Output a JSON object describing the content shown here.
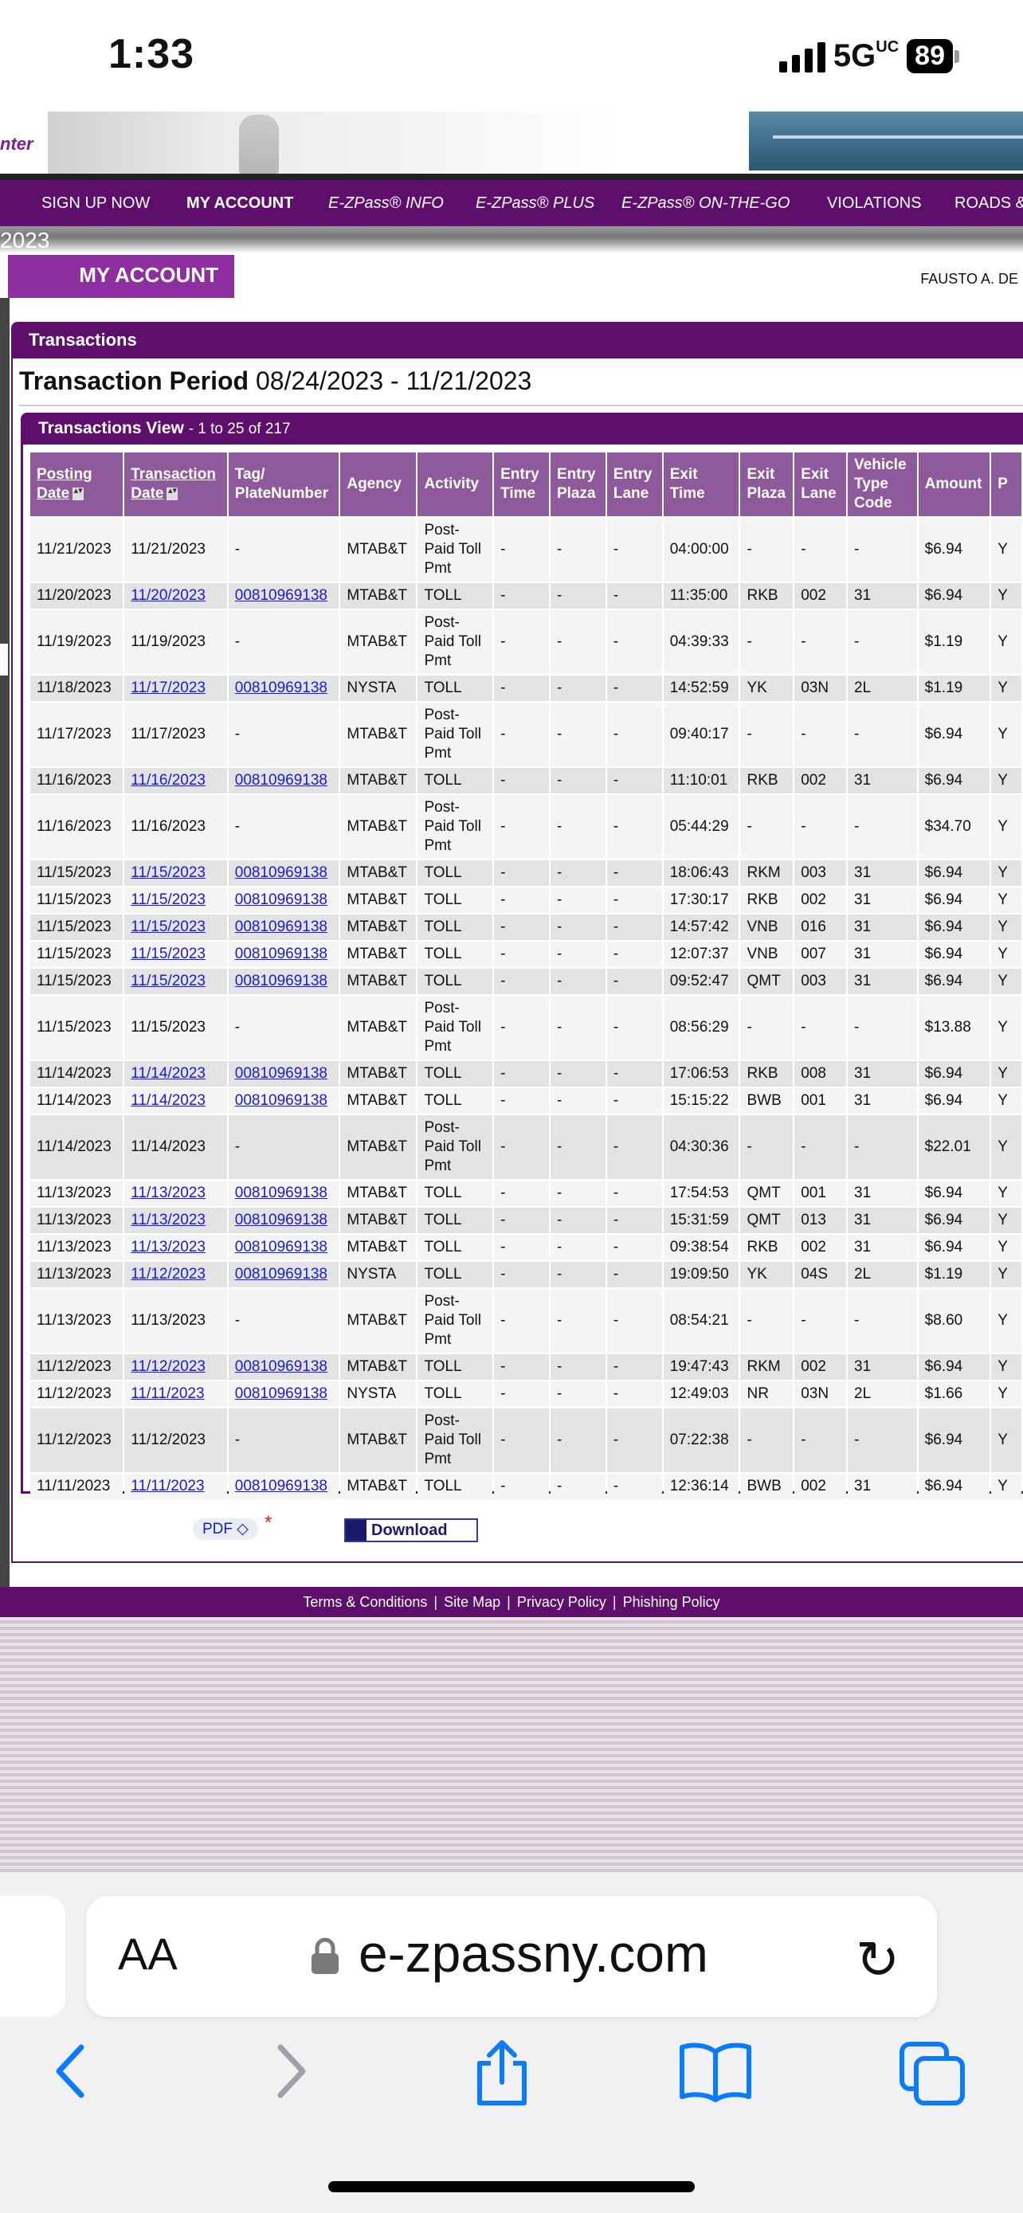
{
  "status_bar": {
    "time": "1:33",
    "network": "5G",
    "network_suffix": "UC",
    "battery": "89"
  },
  "banner": {
    "logo_text": "nter",
    "year": "2023"
  },
  "nav": {
    "items": [
      {
        "label": "SIGN UP NOW"
      },
      {
        "label": "MY ACCOUNT"
      },
      {
        "label": "E-ZPass® INFO"
      },
      {
        "label": "E-ZPass® PLUS"
      },
      {
        "label": "E-ZPass® ON-THE-GO"
      },
      {
        "label": "VIOLATIONS"
      },
      {
        "label": "ROADS &"
      }
    ]
  },
  "account": {
    "tab_label": "MY ACCOUNT",
    "user_name": "FAUSTO A. DE"
  },
  "transactions": {
    "panel_title": "Transactions",
    "period_label": "Transaction Period",
    "period_value": "08/24/2023 - 11/21/2023",
    "view_title": "Transactions View",
    "view_count": "- 1 to 25 of 217",
    "columns": [
      "Posting Date",
      "Transaction Date",
      "Tag/ PlateNumber",
      "Agency",
      "Activity",
      "Entry Time",
      "Entry Plaza",
      "Entry Lane",
      "Exit Time",
      "Exit Plaza",
      "Exit Lane",
      "Vehicle Type Code",
      "Amount",
      "P"
    ],
    "rows": [
      [
        "11/21/2023",
        "11/21/2023",
        "-",
        "MTAB&T",
        "Post-Paid Toll Pmt",
        "-",
        "-",
        "-",
        "04:00:00",
        "-",
        "-",
        "-",
        "$6.94",
        "Y"
      ],
      [
        "11/20/2023",
        "11/20/2023",
        "00810969138",
        "MTAB&T",
        "TOLL",
        "-",
        "-",
        "-",
        "11:35:00",
        "RKB",
        "002",
        "31",
        "$6.94",
        "Y"
      ],
      [
        "11/19/2023",
        "11/19/2023",
        "-",
        "MTAB&T",
        "Post-Paid Toll Pmt",
        "-",
        "-",
        "-",
        "04:39:33",
        "-",
        "-",
        "-",
        "$1.19",
        "Y"
      ],
      [
        "11/18/2023",
        "11/17/2023",
        "00810969138",
        "NYSTA",
        "TOLL",
        "-",
        "-",
        "-",
        "14:52:59",
        "YK",
        "03N",
        "2L",
        "$1.19",
        "Y"
      ],
      [
        "11/17/2023",
        "11/17/2023",
        "-",
        "MTAB&T",
        "Post-Paid Toll Pmt",
        "-",
        "-",
        "-",
        "09:40:17",
        "-",
        "-",
        "-",
        "$6.94",
        "Y"
      ],
      [
        "11/16/2023",
        "11/16/2023",
        "00810969138",
        "MTAB&T",
        "TOLL",
        "-",
        "-",
        "-",
        "11:10:01",
        "RKB",
        "002",
        "31",
        "$6.94",
        "Y"
      ],
      [
        "11/16/2023",
        "11/16/2023",
        "-",
        "MTAB&T",
        "Post-Paid Toll Pmt",
        "-",
        "-",
        "-",
        "05:44:29",
        "-",
        "-",
        "-",
        "$34.70",
        "Y"
      ],
      [
        "11/15/2023",
        "11/15/2023",
        "00810969138",
        "MTAB&T",
        "TOLL",
        "-",
        "-",
        "-",
        "18:06:43",
        "RKM",
        "003",
        "31",
        "$6.94",
        "Y"
      ],
      [
        "11/15/2023",
        "11/15/2023",
        "00810969138",
        "MTAB&T",
        "TOLL",
        "-",
        "-",
        "-",
        "17:30:17",
        "RKB",
        "002",
        "31",
        "$6.94",
        "Y"
      ],
      [
        "11/15/2023",
        "11/15/2023",
        "00810969138",
        "MTAB&T",
        "TOLL",
        "-",
        "-",
        "-",
        "14:57:42",
        "VNB",
        "016",
        "31",
        "$6.94",
        "Y"
      ],
      [
        "11/15/2023",
        "11/15/2023",
        "00810969138",
        "MTAB&T",
        "TOLL",
        "-",
        "-",
        "-",
        "12:07:37",
        "VNB",
        "007",
        "31",
        "$6.94",
        "Y"
      ],
      [
        "11/15/2023",
        "11/15/2023",
        "00810969138",
        "MTAB&T",
        "TOLL",
        "-",
        "-",
        "-",
        "09:52:47",
        "QMT",
        "003",
        "31",
        "$6.94",
        "Y"
      ],
      [
        "11/15/2023",
        "11/15/2023",
        "-",
        "MTAB&T",
        "Post-Paid Toll Pmt",
        "-",
        "-",
        "-",
        "08:56:29",
        "-",
        "-",
        "-",
        "$13.88",
        "Y"
      ],
      [
        "11/14/2023",
        "11/14/2023",
        "00810969138",
        "MTAB&T",
        "TOLL",
        "-",
        "-",
        "-",
        "17:06:53",
        "RKB",
        "008",
        "31",
        "$6.94",
        "Y"
      ],
      [
        "11/14/2023",
        "11/14/2023",
        "00810969138",
        "MTAB&T",
        "TOLL",
        "-",
        "-",
        "-",
        "15:15:22",
        "BWB",
        "001",
        "31",
        "$6.94",
        "Y"
      ],
      [
        "11/14/2023",
        "11/14/2023",
        "-",
        "MTAB&T",
        "Post-Paid Toll Pmt",
        "-",
        "-",
        "-",
        "04:30:36",
        "-",
        "-",
        "-",
        "$22.01",
        "Y"
      ],
      [
        "11/13/2023",
        "11/13/2023",
        "00810969138",
        "MTAB&T",
        "TOLL",
        "-",
        "-",
        "-",
        "17:54:53",
        "QMT",
        "001",
        "31",
        "$6.94",
        "Y"
      ],
      [
        "11/13/2023",
        "11/13/2023",
        "00810969138",
        "MTAB&T",
        "TOLL",
        "-",
        "-",
        "-",
        "15:31:59",
        "QMT",
        "013",
        "31",
        "$6.94",
        "Y"
      ],
      [
        "11/13/2023",
        "11/13/2023",
        "00810969138",
        "MTAB&T",
        "TOLL",
        "-",
        "-",
        "-",
        "09:38:54",
        "RKB",
        "002",
        "31",
        "$6.94",
        "Y"
      ],
      [
        "11/13/2023",
        "11/12/2023",
        "00810969138",
        "NYSTA",
        "TOLL",
        "-",
        "-",
        "-",
        "19:09:50",
        "YK",
        "04S",
        "2L",
        "$1.19",
        "Y"
      ],
      [
        "11/13/2023",
        "11/13/2023",
        "-",
        "MTAB&T",
        "Post-Paid Toll Pmt",
        "-",
        "-",
        "-",
        "08:54:21",
        "-",
        "-",
        "-",
        "$8.60",
        "Y"
      ],
      [
        "11/12/2023",
        "11/12/2023",
        "00810969138",
        "MTAB&T",
        "TOLL",
        "-",
        "-",
        "-",
        "19:47:43",
        "RKM",
        "002",
        "31",
        "$6.94",
        "Y"
      ],
      [
        "11/12/2023",
        "11/11/2023",
        "00810969138",
        "NYSTA",
        "TOLL",
        "-",
        "-",
        "-",
        "12:49:03",
        "NR",
        "03N",
        "2L",
        "$1.66",
        "Y"
      ],
      [
        "11/12/2023",
        "11/12/2023",
        "-",
        "MTAB&T",
        "Post-Paid Toll Pmt",
        "-",
        "-",
        "-",
        "07:22:38",
        "-",
        "-",
        "-",
        "$6.94",
        "Y"
      ],
      [
        "11/11/2023",
        "11/11/2023",
        "00810969138",
        "MTAB&T",
        "TOLL",
        "-",
        "-",
        "-",
        "12:36:14",
        "BWB",
        "002",
        "31",
        "$6.94",
        "Y"
      ]
    ],
    "format_select": "PDF",
    "download_label": "Download"
  },
  "footer": {
    "links": [
      "Terms & Conditions",
      "Site Map",
      "Privacy Policy",
      "Phishing Policy"
    ]
  },
  "safari": {
    "aa": "AA",
    "url": "e-zpassny.com"
  },
  "colors": {
    "brand_purple": "#5e0f6b",
    "header_cell": "#8e5a9b",
    "link": "#1a1ad6",
    "ios_blue": "#0a7aff"
  }
}
